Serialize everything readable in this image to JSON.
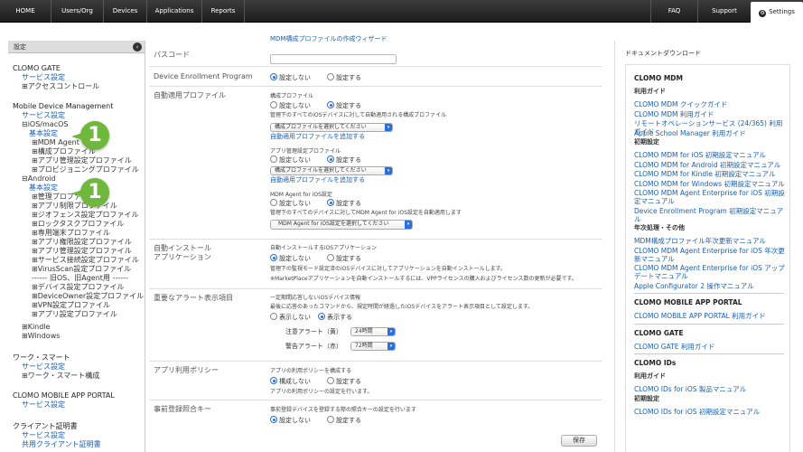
{
  "nav": {
    "home": "HOME",
    "users": "Users/Org",
    "devices": "Devices",
    "applications": "Applications",
    "reports": "Reports",
    "faq": "FAQ",
    "support": "Support",
    "settings": "Settings"
  },
  "left": {
    "header": "設定",
    "items": [
      "CLOMO GATE",
      "サービス設定",
      "⊞アクセスコントロール",
      "Mobile Device Management",
      "サービス設定",
      "⊟iOS/macOS",
      "基本設定",
      "⊞MDM Agent",
      "⊞構成プロファイル",
      "⊞アプリ管理設定プロファイル",
      "⊞プロビジョニングプロファイル",
      "⊟Android",
      "基本設定",
      "⊞管理プロファイル",
      "⊞アプリ制限プロファイル",
      "⊞ジオフェンス設定プロファイル",
      "⊞ロックタスクプロファイル",
      "⊞専用端末プロファイル",
      "⊞アプリ権限設定プロファイル",
      "⊞アプリ管理設定プロファイル",
      "⊞サービス接続設定プロファイル",
      "⊞VirusScan設定プロファイル",
      "------ 旧OS、旧Agent用 ------",
      "⊞デバイス設定プロファイル",
      "⊞DeviceOwner設定プロファイル",
      "⊞VPN設定プロファイル",
      "⊞アプリ設定プロファイル",
      "⊞Kindle",
      "⊞Windows",
      "ワーク・スマート",
      "サービス設定",
      "⊞ワーク・スマート構成",
      "CLOMO MOBILE APP PORTAL",
      "サービス設定",
      "クライアント証明書",
      "サービス設定",
      "共用クライアント証明書"
    ],
    "badges": [
      "1",
      "1"
    ]
  },
  "main": {
    "top_link": "MDM構成プロファイルの作成ウィザード",
    "passcode": "パスコード",
    "dep": {
      "label": "Device Enrollment Program",
      "off": "設定しない",
      "on": "設定する"
    },
    "auto": {
      "label": "自動適用プロファイル",
      "config_title": "構成プロファイル",
      "off1": "設定しない",
      "on1": "設定する",
      "config_desc": "管理下のすべてのiOSデバイスに対して自動適用される構成プロファイル",
      "config_select": "構成プロファイルを選択してください",
      "add1": "自動適用プロファイルを追加する",
      "app_title": "アプリ管理設定プロファイル",
      "off2": "設定しない",
      "on2": "設定する",
      "app_select": "構成プロファイルを選択してください",
      "add2": "自動適用プロファイルを追加する",
      "agent_title": "MDM Agent for iOS設定",
      "off3": "設定しない",
      "on3": "設定する",
      "agent_desc": "管理下のすべてのデバイスに対してMDM Agent for iOS設定を自動適用します",
      "agent_select": "MDM Agent for iOS設定を選択してください"
    },
    "install": {
      "label1": "自動インストール",
      "label2": "アプリケーション",
      "title": "自動インストールするiOSアプリケーション",
      "off": "設定しない",
      "on": "設定する",
      "desc1": "管理下の監視モード設定済のiOSデバイスに対してアプリケーションを自動インストールします。",
      "desc2": "※MarketPlaceアプリケーションを自動インストールするには、VPPライセンスの購入およびライセンス数の更新が必要です。"
    },
    "alert": {
      "label": "重要なアラート表示項目",
      "title": "一定期間応答しないiOSデバイス情報",
      "desc": "最後に応答のあったコマンドから、規定時間が経過したiOSデバイスをアラート表示項目として設定します。",
      "off": "表示しない",
      "on": "表示する",
      "yellow_label": "注意アラート（黄）",
      "yellow_value": "24時間",
      "red_label": "警告アラート（赤）",
      "red_value": "72時間"
    },
    "policy": {
      "label": "アプリ利用ポリシー",
      "title": "アプリの利用ポリシーを構成する",
      "off": "構成しない",
      "on": "設定する",
      "desc": "アプリの利用ポリシーの設定を行います。"
    },
    "prereg": {
      "label": "事前登録照合キー",
      "title": "事前登録デバイスを登録する際の照合キーの設定を行います",
      "off": "設定しない",
      "on": "設定する"
    },
    "save": "保存"
  },
  "right": {
    "title": "ドキュメントダウンロード",
    "items": [
      {
        "k": "h",
        "t": "CLOMO MDM"
      },
      {
        "k": "h2",
        "t": "利用ガイド"
      },
      {
        "k": "a",
        "t": "CLOMO MDM クイックガイド"
      },
      {
        "k": "a",
        "t": "CLOMO MDM 利用ガイド"
      },
      {
        "k": "a",
        "t": "リモートオペレーションサービス (24/365) 利用ガイド"
      },
      {
        "k": "a",
        "t": "Apple School Manager 利用ガイド"
      },
      {
        "k": "h2",
        "t": "初期設定"
      },
      {
        "k": "a",
        "t": "CLOMO MDM for iOS 初期設定マニュアル"
      },
      {
        "k": "a",
        "t": "CLOMO MDM for Android 初期設定マニュアル"
      },
      {
        "k": "a",
        "t": "CLOMO MDM for Kindle 初期設定マニュアル"
      },
      {
        "k": "a",
        "t": "CLOMO MDM for Windows 初期設定マニュアル"
      },
      {
        "k": "a",
        "t": "CLOMO MDM Agent Enterprise for iOS 初期設定マニュアル"
      },
      {
        "k": "a",
        "t": "Device Enrollment Program 初期設定マニュアル"
      },
      {
        "k": "h2",
        "t": "年次処理・その他"
      },
      {
        "k": "a",
        "t": "MDM構成プロファイル年次更新マニュアル"
      },
      {
        "k": "a",
        "t": "CLOMO MDM Agent Enterprise for iOS 年次更新マニュアル"
      },
      {
        "k": "a",
        "t": "CLOMO MDM Agent Enterprise for iOS アップデートマニュアル"
      },
      {
        "k": "a",
        "t": "Apple Configurator 2 操作マニュアル"
      },
      {
        "k": "h",
        "t": "CLOMO MOBILE APP PORTAL"
      },
      {
        "k": "a",
        "t": "CLOMO MOBILE APP PORTAL 利用ガイド"
      },
      {
        "k": "h",
        "t": "CLOMO GATE"
      },
      {
        "k": "a",
        "t": "CLOMO GATE 利用ガイド"
      },
      {
        "k": "h",
        "t": "CLOMO IDs"
      },
      {
        "k": "h2",
        "t": "利用ガイド"
      },
      {
        "k": "a",
        "t": "CLOMO IDs for iOS 製品マニュアル"
      },
      {
        "k": "h2",
        "t": "初期設定"
      },
      {
        "k": "a",
        "t": "CLOMO IDs for iOS 初期設定マニュアル"
      }
    ]
  }
}
